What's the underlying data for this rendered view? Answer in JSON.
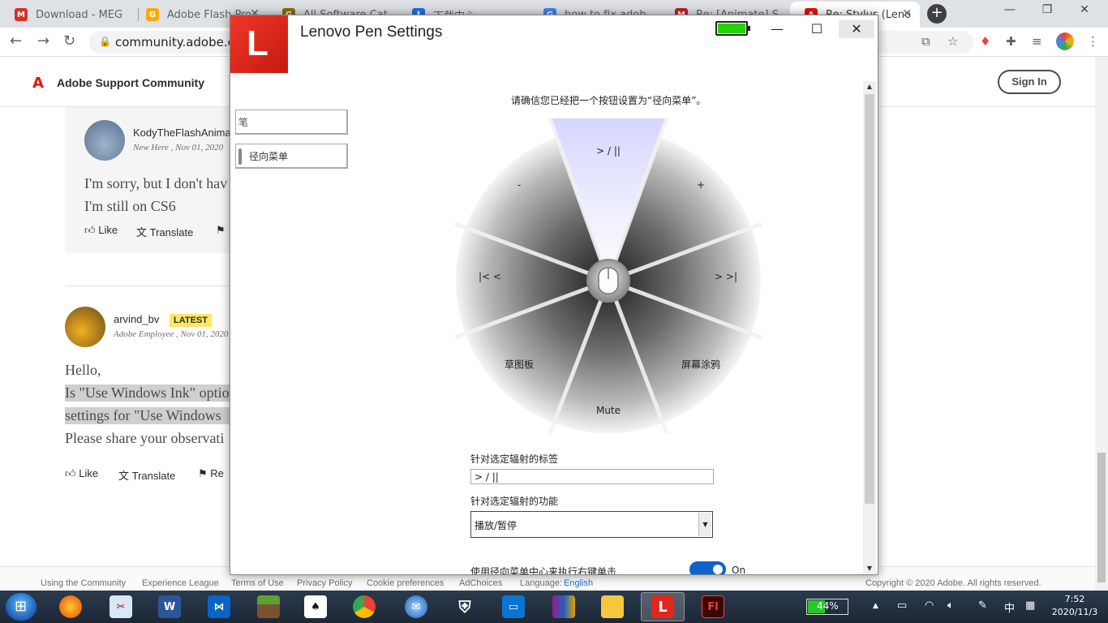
{
  "browser": {
    "tabs": [
      {
        "label": "Download - MEG",
        "color": "#d93025",
        "glyph": "M"
      },
      {
        "label": "Adobe Flash Pro",
        "color": "#f9ab00",
        "glyph": "G"
      },
      {
        "label": "All Software Cat",
        "color": "#8d6e00",
        "glyph": "G"
      },
      {
        "label": "下载中心",
        "color": "#1a73e8",
        "glyph": "⬇"
      },
      {
        "label": "how to fix adob",
        "color": "#4285f4",
        "glyph": "G"
      },
      {
        "label": "Re: [Animate] S",
        "color": "#c5221f",
        "glyph": "M"
      },
      {
        "label": "Re: Stylus (Leno",
        "color": "#eb1000",
        "glyph": "A"
      }
    ],
    "url": "community.adobe.co",
    "new_tab": "+",
    "win_min": "—",
    "win_max": "❐",
    "win_close": "✕"
  },
  "site": {
    "name": "Adobe Support Community",
    "logo": "A",
    "sign_in": "Sign In"
  },
  "post1": {
    "user": "KodyTheFlashAnima",
    "meta": "New Here , Nov 01, 2020",
    "line1": "I'm sorry, but I don't hav",
    "line2": "I'm still on CS6",
    "like": "Like",
    "translate": "Translate"
  },
  "post2": {
    "user": "arvind_bv",
    "badge": "LATEST",
    "meta": "Adobe Employee , Nov 01, 2020",
    "line1": "Hello,",
    "line2": "Is \"Use Windows Ink\" optio",
    "line3": "settings for \"Use Windows",
    "line4": "Please share your observati",
    "like": "Like",
    "translate": "Translate",
    "reply": "Re"
  },
  "footer": {
    "links": [
      "Using the Community",
      "Experience League",
      "Terms of Use",
      "Privacy Policy",
      "Cookie preferences",
      "AdChoices"
    ],
    "language_label": "Language:",
    "language_value": "English",
    "copyright": "Copyright © 2020 Adobe. All rights reserved."
  },
  "pen": {
    "logo": "L",
    "title": "Lenovo Pen Settings",
    "battery_level": 1.0,
    "minimize": "—",
    "maximize": "☐",
    "close": "✕",
    "nav": [
      "笔",
      "径向菜单"
    ],
    "hint": "请确信您已经把一个按钮设置为“径向菜单”。",
    "radial_labels": {
      "top": "> / ||",
      "top_right": "+",
      "right": "> >|",
      "bottom_right": "屏幕涂鸦",
      "bottom": "Mute",
      "bottom_left": "草图板",
      "left": "|< <",
      "top_left": "-"
    },
    "label_field_title": "针对选定辐射的标签",
    "label_field_value": "> / ||",
    "function_field_title": "针对选定辐射的功能",
    "function_value": "播放/暂停",
    "center_click_label": "使用径向菜单中心来执行右键单击",
    "toggle_state": "On"
  },
  "taskbar": {
    "battery": "44%",
    "battery_level": 0.44,
    "ime": "中",
    "time": "7:52",
    "date": "2020/11/3"
  }
}
